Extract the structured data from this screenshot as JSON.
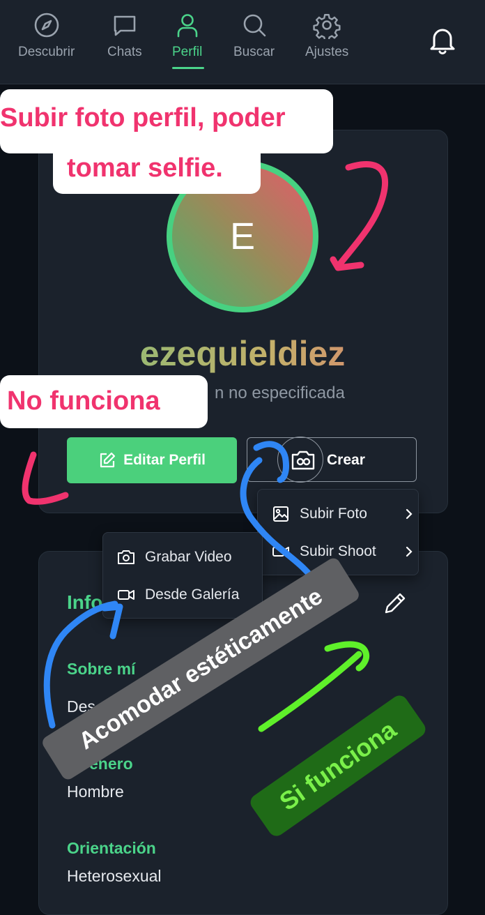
{
  "nav": {
    "items": [
      {
        "label": "Descubrir",
        "icon": "compass-icon"
      },
      {
        "label": "Chats",
        "icon": "chat-bubble-icon"
      },
      {
        "label": "Perfil",
        "icon": "user-icon",
        "active": true
      },
      {
        "label": "Buscar",
        "icon": "search-icon"
      },
      {
        "label": "Ajustes",
        "icon": "gear-icon"
      }
    ],
    "notifications_icon": "bell-icon"
  },
  "profile": {
    "avatar_initial": "E",
    "username": "ezequieldiez",
    "location_text": "n no especificada",
    "edit_button": "Editar Perfil",
    "create_button": "Crear"
  },
  "create_menu": {
    "items": [
      {
        "label": "Subir Foto",
        "icon": "image-icon"
      },
      {
        "label": "Subir Shoot",
        "icon": "video-camera-icon"
      }
    ]
  },
  "media_menu": {
    "items": [
      {
        "label": "Grabar Video",
        "icon": "camera-icon"
      },
      {
        "label": "Desde Galería",
        "icon": "video-camera-icon"
      }
    ]
  },
  "info": {
    "title": "Info",
    "fields": [
      {
        "label": "Sobre mí",
        "value": "Des"
      },
      {
        "label": "enero",
        "value": "Hombre"
      },
      {
        "label": "Orientación",
        "value": "Heterosexual"
      }
    ]
  },
  "annotations": {
    "photo_note_line1": "Subir foto perfil, poder",
    "photo_note_line2": "tomar selfie.",
    "edit_note": "No funciona",
    "layout_note": "Acomodar estéticamente",
    "works_note": "Si funciona"
  },
  "colors": {
    "background": "#0c1118",
    "surface": "#1b222c",
    "accent": "#4bd48a",
    "annotation_pink": "#f0336e",
    "annotation_blue": "#2f86f5",
    "annotation_green": "#5ff02a"
  }
}
